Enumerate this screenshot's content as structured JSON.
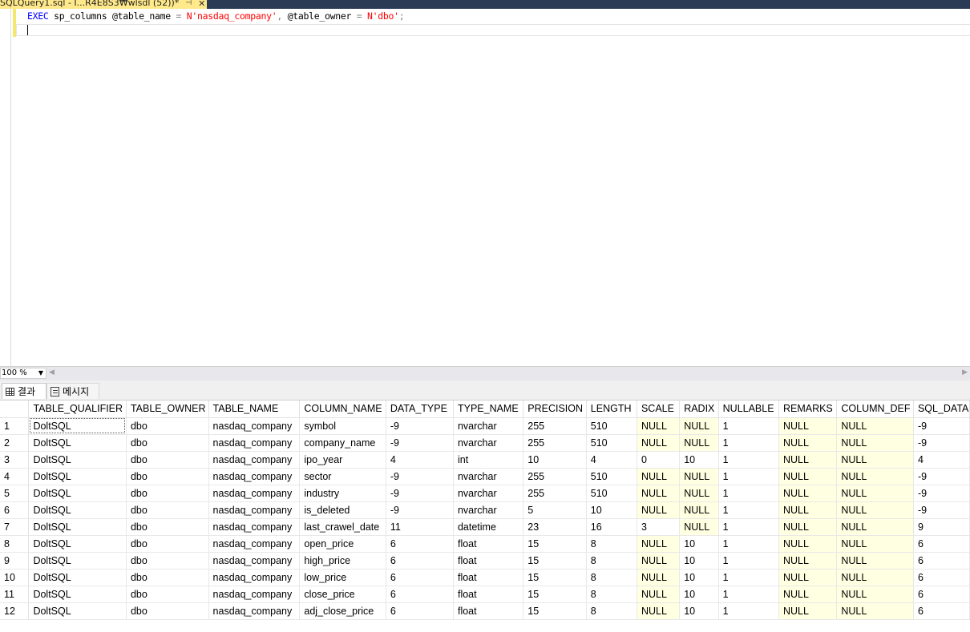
{
  "tab": {
    "title": "SQLQuery1.sql - I...R4E8S3₩wlsdl (52))*",
    "pin_glyph": "⊣",
    "close_glyph": "✕"
  },
  "editor": {
    "kw_exec": "EXEC",
    "proc": "sp_columns",
    "p1": "@table_name",
    "eq1": "=",
    "v1": "N'nasdaq_company'",
    "comma": ",",
    "p2": "@table_owner",
    "eq2": "=",
    "v2": "N'dbo'",
    "semi": ";"
  },
  "zoom": {
    "value": "100 %"
  },
  "results_tabs": {
    "results": "결과",
    "messages": "메시지"
  },
  "grid": {
    "columns": [
      "",
      "TABLE_QUALIFIER",
      "TABLE_OWNER",
      "TABLE_NAME",
      "COLUMN_NAME",
      "DATA_TYPE",
      "TYPE_NAME",
      "PRECISION",
      "LENGTH",
      "SCALE",
      "RADIX",
      "NULLABLE",
      "REMARKS",
      "COLUMN_DEF",
      "SQL_DATA"
    ],
    "rows": [
      [
        "1",
        "DoltSQL",
        "dbo",
        "nasdaq_company",
        "symbol",
        "-9",
        "nvarchar",
        "255",
        "510",
        "NULL",
        "NULL",
        "1",
        "NULL",
        "NULL",
        "-9"
      ],
      [
        "2",
        "DoltSQL",
        "dbo",
        "nasdaq_company",
        "company_name",
        "-9",
        "nvarchar",
        "255",
        "510",
        "NULL",
        "NULL",
        "1",
        "NULL",
        "NULL",
        "-9"
      ],
      [
        "3",
        "DoltSQL",
        "dbo",
        "nasdaq_company",
        "ipo_year",
        "4",
        "int",
        "10",
        "4",
        "0",
        "10",
        "1",
        "NULL",
        "NULL",
        "4"
      ],
      [
        "4",
        "DoltSQL",
        "dbo",
        "nasdaq_company",
        "sector",
        "-9",
        "nvarchar",
        "255",
        "510",
        "NULL",
        "NULL",
        "1",
        "NULL",
        "NULL",
        "-9"
      ],
      [
        "5",
        "DoltSQL",
        "dbo",
        "nasdaq_company",
        "industry",
        "-9",
        "nvarchar",
        "255",
        "510",
        "NULL",
        "NULL",
        "1",
        "NULL",
        "NULL",
        "-9"
      ],
      [
        "6",
        "DoltSQL",
        "dbo",
        "nasdaq_company",
        "is_deleted",
        "-9",
        "nvarchar",
        "5",
        "10",
        "NULL",
        "NULL",
        "1",
        "NULL",
        "NULL",
        "-9"
      ],
      [
        "7",
        "DoltSQL",
        "dbo",
        "nasdaq_company",
        "last_crawel_date",
        "11",
        "datetime",
        "23",
        "16",
        "3",
        "NULL",
        "1",
        "NULL",
        "NULL",
        "9"
      ],
      [
        "8",
        "DoltSQL",
        "dbo",
        "nasdaq_company",
        "open_price",
        "6",
        "float",
        "15",
        "8",
        "NULL",
        "10",
        "1",
        "NULL",
        "NULL",
        "6"
      ],
      [
        "9",
        "DoltSQL",
        "dbo",
        "nasdaq_company",
        "high_price",
        "6",
        "float",
        "15",
        "8",
        "NULL",
        "10",
        "1",
        "NULL",
        "NULL",
        "6"
      ],
      [
        "10",
        "DoltSQL",
        "dbo",
        "nasdaq_company",
        "low_price",
        "6",
        "float",
        "15",
        "8",
        "NULL",
        "10",
        "1",
        "NULL",
        "NULL",
        "6"
      ],
      [
        "11",
        "DoltSQL",
        "dbo",
        "nasdaq_company",
        "close_price",
        "6",
        "float",
        "15",
        "8",
        "NULL",
        "10",
        "1",
        "NULL",
        "NULL",
        "6"
      ],
      [
        "12",
        "DoltSQL",
        "dbo",
        "nasdaq_company",
        "adj_close_price",
        "6",
        "float",
        "15",
        "8",
        "NULL",
        "10",
        "1",
        "NULL",
        "NULL",
        "6"
      ]
    ]
  },
  "colors": {
    "tab_active": "#ffe98a",
    "tabbar_bg": "#2b3a55",
    "null_cell_bg": "#ffffe1",
    "sql_keyword": "#0000ff",
    "sql_string": "#ff0000"
  }
}
